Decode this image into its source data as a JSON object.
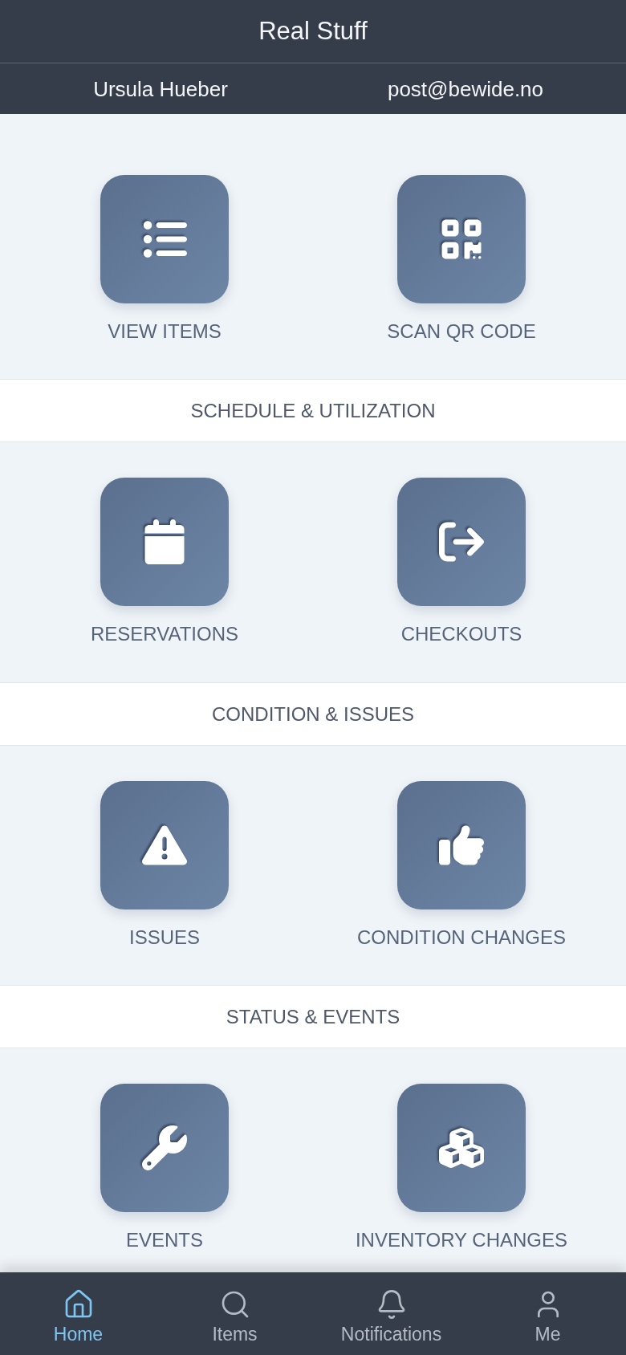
{
  "app_bar": {
    "title": "Real Stuff"
  },
  "user": {
    "name": "Ursula Hueber",
    "email": "post@bewide.no"
  },
  "sections": [
    {
      "tiles": [
        {
          "label": "VIEW ITEMS"
        },
        {
          "label": "SCAN QR CODE"
        }
      ]
    },
    {
      "heading": "SCHEDULE & UTILIZATION",
      "tiles": [
        {
          "label": "RESERVATIONS"
        },
        {
          "label": "CHECKOUTS"
        }
      ]
    },
    {
      "heading": "CONDITION & ISSUES",
      "tiles": [
        {
          "label": "ISSUES"
        },
        {
          "label": "CONDITION CHANGES"
        }
      ]
    },
    {
      "heading": "STATUS & EVENTS",
      "tiles": [
        {
          "label": "EVENTS"
        },
        {
          "label": "INVENTORY CHANGES"
        }
      ]
    }
  ],
  "tab_bar": [
    {
      "label": "Home",
      "selected": true
    },
    {
      "label": "Items",
      "selected": false
    },
    {
      "label": "Notifications",
      "selected": false
    },
    {
      "label": "Me",
      "selected": false
    }
  ]
}
